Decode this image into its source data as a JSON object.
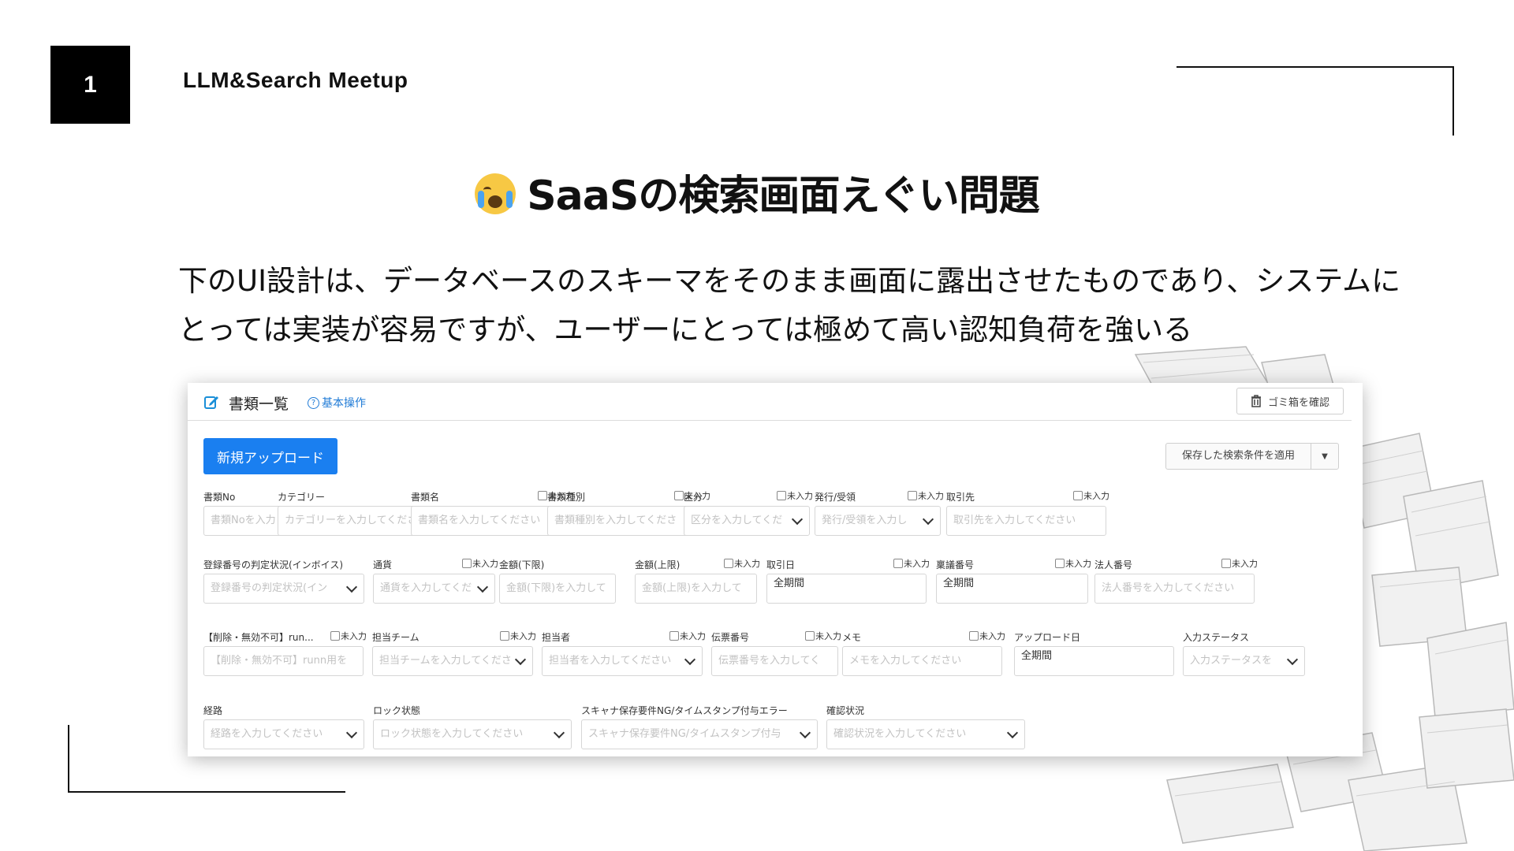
{
  "slide": {
    "number": "1",
    "brand": "LLM&Search Meetup",
    "title": "SaaSの検索画面えぐい問題",
    "description": "下のUI設計は、データベースのスキーマをそのまま画面に露出させたものであり、システムにとっては実装が容易ですが、ユーザーにとっては極めて高い認知負荷を強いる"
  },
  "app": {
    "header_title": "書類一覧",
    "help_label": "基本操作",
    "trash_button": "ゴミ箱を確認",
    "upload_button": "新規アップロード",
    "saved_search_button": "保存した検索条件を適用",
    "unset_label": "未入力",
    "fields": [
      {
        "label": "書類No",
        "placeholder": "書類Noを入力",
        "select": false,
        "unset": false
      },
      {
        "label": "カテゴリー",
        "placeholder": "カテゴリーを入力してくださ",
        "select": true,
        "unset": false
      },
      {
        "label": "書類名",
        "placeholder": "書類名を入力してください",
        "select": false,
        "unset": true
      },
      {
        "label": "書類種別",
        "placeholder": "書類種別を入力してくださ",
        "select": true,
        "unset": true
      },
      {
        "label": "区分",
        "placeholder": "区分を入力してくだ",
        "select": true,
        "unset": true
      },
      {
        "label": "発行/受領",
        "placeholder": "発行/受領を入力し",
        "select": true,
        "unset": true
      },
      {
        "label": "取引先",
        "placeholder": "取引先を入力してください",
        "select": false,
        "unset": true
      },
      {
        "label": "登録番号の判定状況(インボイス)",
        "placeholder": "登録番号の判定状況(イン",
        "select": true,
        "unset": false
      },
      {
        "label": "通貨",
        "placeholder": "通貨を入力してくだ",
        "select": true,
        "unset": true
      },
      {
        "label": "金額(下限)",
        "placeholder": "金額(下限)を入力して",
        "select": false,
        "unset": false
      },
      {
        "label": "金額(上限)",
        "placeholder": "金額(上限)を入力して",
        "select": false,
        "unset": true
      },
      {
        "label": "取引日",
        "value": "全期間",
        "select": false,
        "unset": true
      },
      {
        "label": "稟議番号",
        "value": "全期間",
        "select": false,
        "unset": true
      },
      {
        "label": "法人番号",
        "placeholder": "法人番号を入力してください",
        "select": false,
        "unset": true
      },
      {
        "label": "【削除・無効不可】run...",
        "placeholder": "【削除・無効不可】runn用を",
        "select": false,
        "unset": true
      },
      {
        "label": "担当チーム",
        "placeholder": "担当チームを入力してくださ",
        "select": true,
        "unset": true
      },
      {
        "label": "担当者",
        "placeholder": "担当者を入力してください",
        "select": true,
        "unset": true
      },
      {
        "label": "伝票番号",
        "placeholder": "伝票番号を入力してく",
        "select": false,
        "unset": true
      },
      {
        "label": "メモ",
        "placeholder": "メモを入力してください",
        "select": false,
        "unset": true
      },
      {
        "label": "アップロード日",
        "value": "全期間",
        "select": false,
        "unset": false
      },
      {
        "label": "入力ステータス",
        "placeholder": "入力ステータスを",
        "select": true,
        "unset": false
      },
      {
        "label": "経路",
        "placeholder": "経路を入力してください",
        "select": true,
        "unset": false
      },
      {
        "label": "ロック状態",
        "placeholder": "ロック状態を入力してください",
        "select": true,
        "unset": false
      },
      {
        "label": "スキャナ保存要件NG/タイムスタンプ付与エラー",
        "placeholder": "スキャナ保存要件NG/タイムスタンプ付与",
        "select": true,
        "unset": false
      },
      {
        "label": "確認状況",
        "placeholder": "確認状況を入力してください",
        "select": true,
        "unset": false
      }
    ]
  },
  "colors": {
    "accent": "#1a7ff0",
    "help_link": "#1e7ad6",
    "slide_number_bg": "#000000"
  },
  "icons": [
    "crying-face-emoji",
    "edit-icon",
    "help-circle-icon",
    "trash-icon",
    "chevron-down-icon",
    "book-stack-illustration"
  ]
}
